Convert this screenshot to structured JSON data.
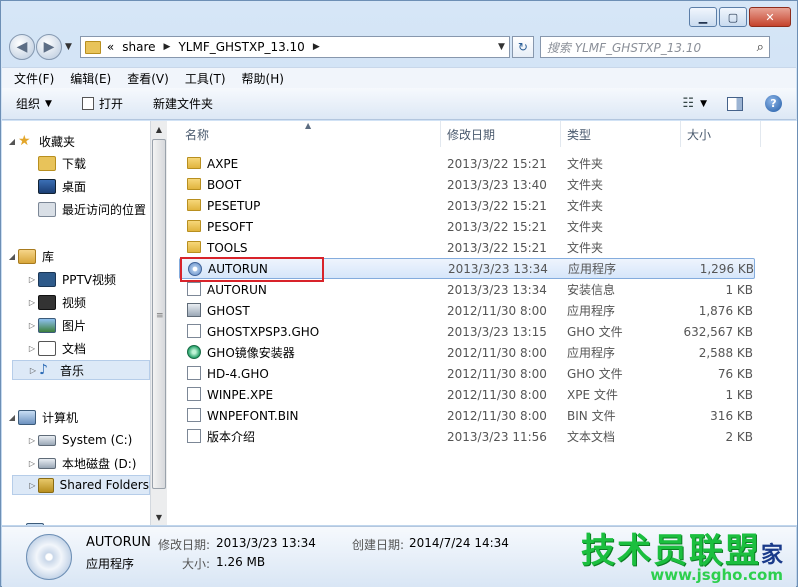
{
  "address": {
    "overflow": "«",
    "crumbs": [
      "share",
      "YLMF_GHSTXP_13.10"
    ]
  },
  "search": {
    "placeholder": "搜索 YLMF_GHSTXP_13.10"
  },
  "menu": [
    "文件(F)",
    "编辑(E)",
    "查看(V)",
    "工具(T)",
    "帮助(H)"
  ],
  "toolbar": {
    "organize": "组织",
    "open": "打开",
    "new_folder": "新建文件夹"
  },
  "nav": {
    "favorites": "收藏夹",
    "downloads": "下载",
    "desktop": "桌面",
    "recent": "最近访问的位置",
    "libraries": "库",
    "pptv": "PPTV视频",
    "videos": "视频",
    "pictures": "图片",
    "documents": "文档",
    "music": "音乐",
    "computer": "计算机",
    "system_c": "System (C:)",
    "local_d": "本地磁盘 (D:)",
    "shared": "Shared Folders"
  },
  "columns": {
    "name": "名称",
    "date": "修改日期",
    "type": "类型",
    "size": "大小"
  },
  "files": [
    {
      "name": "AXPE",
      "date": "2013/3/22 15:21",
      "type": "文件夹",
      "size": "",
      "icon": "folder-icon"
    },
    {
      "name": "BOOT",
      "date": "2013/3/23 13:40",
      "type": "文件夹",
      "size": "",
      "icon": "folder-icon"
    },
    {
      "name": "PESETUP",
      "date": "2013/3/22 15:21",
      "type": "文件夹",
      "size": "",
      "icon": "folder-icon"
    },
    {
      "name": "PESOFT",
      "date": "2013/3/22 15:21",
      "type": "文件夹",
      "size": "",
      "icon": "folder-icon"
    },
    {
      "name": "TOOLS",
      "date": "2013/3/22 15:21",
      "type": "文件夹",
      "size": "",
      "icon": "folder-icon"
    },
    {
      "name": "AUTORUN",
      "date": "2013/3/23 13:34",
      "type": "应用程序",
      "size": "1,296 KB",
      "icon": "disc-app-icon"
    },
    {
      "name": "AUTORUN",
      "date": "2013/3/23 13:34",
      "type": "安装信息",
      "size": "1 KB",
      "icon": "setup-info-icon"
    },
    {
      "name": "GHOST",
      "date": "2012/11/30 8:00",
      "type": "应用程序",
      "size": "1,876 KB",
      "icon": "ghost-app-icon"
    },
    {
      "name": "GHOSTXPSP3.GHO",
      "date": "2013/3/23 13:15",
      "type": "GHO 文件",
      "size": "632,567 KB",
      "icon": "file-icon"
    },
    {
      "name": "GHO镜像安装器",
      "date": "2012/11/30 8:00",
      "type": "应用程序",
      "size": "2,588 KB",
      "icon": "installer-icon"
    },
    {
      "name": "HD-4.GHO",
      "date": "2012/11/30 8:00",
      "type": "GHO 文件",
      "size": "76 KB",
      "icon": "file-icon"
    },
    {
      "name": "WINPE.XPE",
      "date": "2012/11/30 8:00",
      "type": "XPE 文件",
      "size": "1 KB",
      "icon": "file-icon"
    },
    {
      "name": "WNPEFONT.BIN",
      "date": "2012/11/30 8:00",
      "type": "BIN 文件",
      "size": "316 KB",
      "icon": "file-icon"
    },
    {
      "name": "版本介绍",
      "date": "2013/3/23 11:56",
      "type": "文本文档",
      "size": "2 KB",
      "icon": "text-doc-icon"
    }
  ],
  "details": {
    "name": "AUTORUN",
    "type": "应用程序",
    "modified_label": "修改日期:",
    "modified": "2013/3/23 13:34",
    "created_label": "创建日期:",
    "created": "2014/7/24 14:34",
    "size_label": "大小:",
    "size": "1.26 MB"
  },
  "watermark": {
    "big": "技术员联盟",
    "small": "www.jsgho.com",
    "extra": "家"
  }
}
